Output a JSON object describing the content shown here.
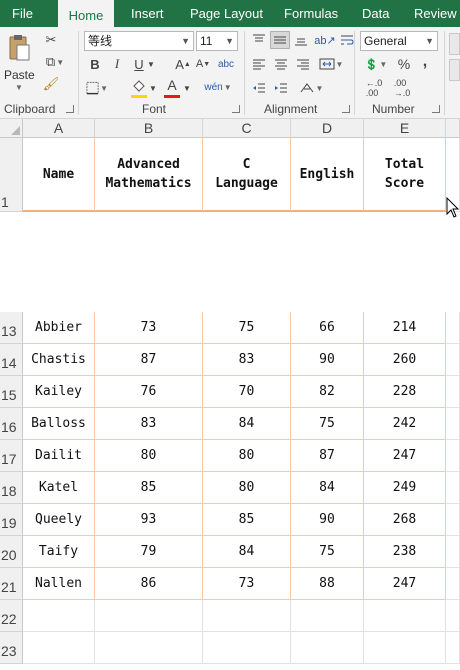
{
  "tabs": [
    "File",
    "Home",
    "Insert",
    "Page Layout",
    "Formulas",
    "Data",
    "Review"
  ],
  "active_tab": "Home",
  "clipboard": {
    "paste_label": "Paste",
    "group_label": "Clipboard"
  },
  "font": {
    "name": "等线",
    "size": "11",
    "group_label": "Font",
    "bold": "B",
    "italic": "I",
    "underline": "U",
    "grow": "A",
    "shrink": "A",
    "abc": "abc",
    "font_color": "A",
    "font_color_hex": "#e41b17",
    "fill_color_hex": "#ffd700"
  },
  "alignment": {
    "group_label": "Alignment"
  },
  "number": {
    "format": "General",
    "group_label": "Number",
    "percent": "%",
    "comma": ","
  },
  "columns": [
    "A",
    "B",
    "C",
    "D",
    "E"
  ],
  "headers": {
    "name": "Name",
    "adv_math": "Advanced\nMathematics",
    "c_lang": "C\nLanguage",
    "english": "English",
    "total": "Total\nScore"
  },
  "row_numbers": [
    "1",
    "13",
    "14",
    "15",
    "16",
    "17",
    "18",
    "19",
    "20",
    "21",
    "22",
    "23"
  ],
  "rows": [
    {
      "name": "Abbier",
      "adv_math": "73",
      "c_lang": "75",
      "english": "66",
      "total": "214"
    },
    {
      "name": "Chastis",
      "adv_math": "87",
      "c_lang": "83",
      "english": "90",
      "total": "260"
    },
    {
      "name": "Kailey",
      "adv_math": "76",
      "c_lang": "70",
      "english": "82",
      "total": "228"
    },
    {
      "name": "Balloss",
      "adv_math": "83",
      "c_lang": "84",
      "english": "75",
      "total": "242"
    },
    {
      "name": "Dailit",
      "adv_math": "80",
      "c_lang": "80",
      "english": "87",
      "total": "247"
    },
    {
      "name": "Katel",
      "adv_math": "85",
      "c_lang": "80",
      "english": "84",
      "total": "249"
    },
    {
      "name": "Queely",
      "adv_math": "93",
      "c_lang": "85",
      "english": "90",
      "total": "268"
    },
    {
      "name": "Taify",
      "adv_math": "79",
      "c_lang": "84",
      "english": "75",
      "total": "238"
    },
    {
      "name": "Nallen",
      "adv_math": "86",
      "c_lang": "73",
      "english": "88",
      "total": "247"
    }
  ],
  "colors": {
    "ribbon_green": "#217346",
    "table_border": "#f4c8a8"
  }
}
